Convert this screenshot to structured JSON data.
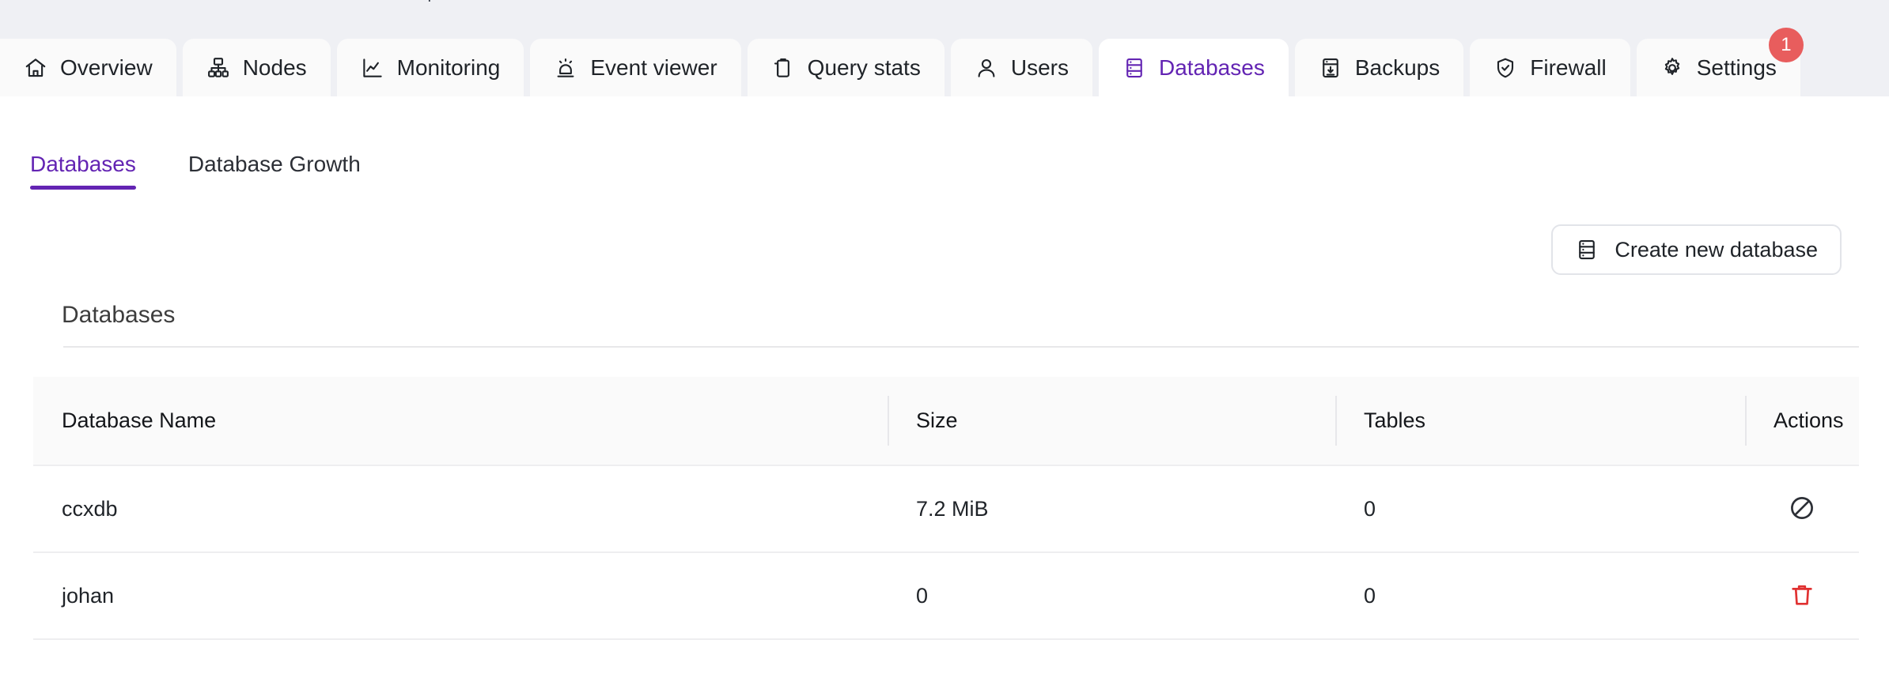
{
  "topbar": {
    "crumb_fragment": "|",
    "tabs": [
      {
        "label": "Overview",
        "icon": "home-icon",
        "active": false
      },
      {
        "label": "Nodes",
        "icon": "nodes-icon",
        "active": false
      },
      {
        "label": "Monitoring",
        "icon": "chart-line-icon",
        "active": false
      },
      {
        "label": "Event viewer",
        "icon": "siren-icon",
        "active": false
      },
      {
        "label": "Query stats",
        "icon": "clipboard-icon",
        "active": false
      },
      {
        "label": "Users",
        "icon": "user-icon",
        "active": false
      },
      {
        "label": "Databases",
        "icon": "database-icon",
        "active": true
      },
      {
        "label": "Backups",
        "icon": "backup-icon",
        "active": false
      },
      {
        "label": "Firewall",
        "icon": "shield-check-icon",
        "active": false
      },
      {
        "label": "Settings",
        "icon": "gear-icon",
        "active": false,
        "badge": "1"
      }
    ]
  },
  "subtabs": [
    {
      "label": "Databases",
      "active": true
    },
    {
      "label": "Database Growth",
      "active": false
    }
  ],
  "actions": {
    "create_database_label": "Create new database",
    "create_database_icon": "database-icon"
  },
  "card": {
    "title": "Databases"
  },
  "table": {
    "columns": [
      "Database Name",
      "Size",
      "Tables",
      "Actions"
    ],
    "rows": [
      {
        "name": "ccxdb",
        "size": "7.2 MiB",
        "tables": "0",
        "action_icon": "ban-icon"
      },
      {
        "name": "johan",
        "size": "0",
        "tables": "0",
        "action_icon": "trash-icon"
      }
    ]
  },
  "colors": {
    "accent_purple": "#6324b3",
    "badge_red": "#e85d5d",
    "trash_red": "#e03131",
    "topbar_bg": "#eff0f4",
    "tab_bg": "#fafafa",
    "page_bg": "#ffffff"
  }
}
